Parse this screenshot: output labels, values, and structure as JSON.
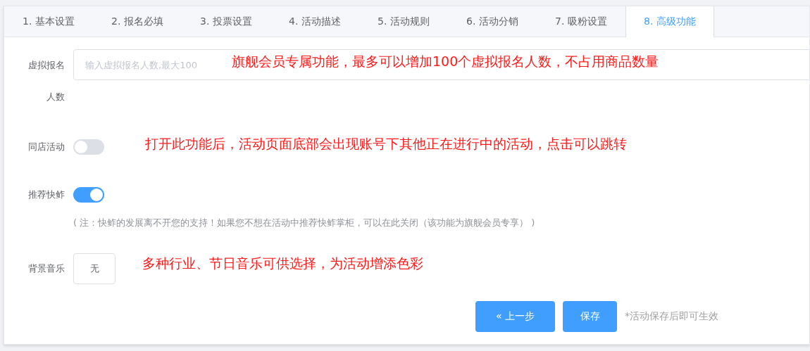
{
  "tabs": [
    {
      "label": "1. 基本设置",
      "selected": false
    },
    {
      "label": "2. 报名必填",
      "selected": false
    },
    {
      "label": "3. 投票设置",
      "selected": false
    },
    {
      "label": "4. 活动描述",
      "selected": false
    },
    {
      "label": "5. 活动规则",
      "selected": false
    },
    {
      "label": "6. 活动分销",
      "selected": false
    },
    {
      "label": "7. 吸粉设置",
      "selected": false
    },
    {
      "label": "8. 高级功能",
      "selected": true
    }
  ],
  "fields": [
    {
      "kind": "input",
      "label": "虚拟报名人数",
      "placeholder": "输入虚拟报名人数,最大100",
      "annotation": "旗舰会员专属功能，最多可以增加100个虚拟报名人数，不占用商品数量"
    },
    {
      "kind": "switch",
      "label": "同店活动",
      "on": false,
      "annotation": "打开此功能后，活动页面底部会出现账号下其他正在进行中的活动，点击可以跳转"
    },
    {
      "kind": "switch",
      "label": "推荐快鲊",
      "on": true,
      "note": "( 注：快鲊的发展离不开您的支持！如果您不想在活动中推荐快鲊掌柜，可以在此关闭（该功能为旗舰会员专享） )"
    },
    {
      "kind": "select",
      "label": "背景音乐",
      "value": "无",
      "annotation": "多种行业、节日音乐可供选择，为活动增添色彩"
    }
  ],
  "actions": {
    "prev": "« 上一步",
    "save": "保存",
    "hint": "*活动保存后即可生效"
  }
}
